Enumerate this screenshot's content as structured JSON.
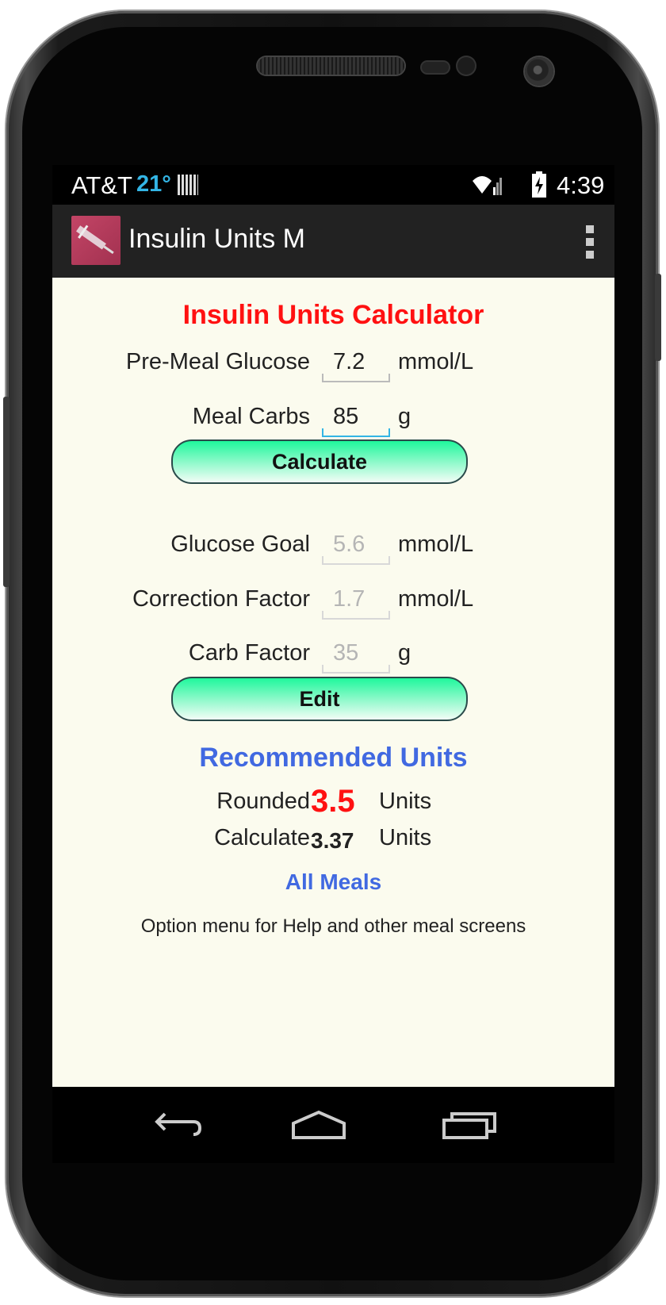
{
  "status_bar": {
    "carrier": "AT&T",
    "temperature": "21°",
    "time": "4:39"
  },
  "action_bar": {
    "title": "Insulin Units M",
    "app_icon": "syringe-icon",
    "menu_icon": "overflow-menu-icon"
  },
  "calculator": {
    "title": "Insulin Units Calculator",
    "pre_meal_glucose": {
      "label": "Pre-Meal Glucose",
      "value": "7.2",
      "unit": "mmol/L"
    },
    "meal_carbs": {
      "label": "Meal Carbs",
      "value": "85",
      "unit": "g"
    },
    "calculate_label": "Calculate"
  },
  "settings": {
    "glucose_goal": {
      "label": "Glucose Goal",
      "value": "5.6",
      "unit": "mmol/L"
    },
    "correction_factor": {
      "label": "Correction Factor",
      "value": "1.7",
      "unit": "mmol/L"
    },
    "carb_factor": {
      "label": "Carb Factor",
      "value": "35",
      "unit": "g"
    },
    "edit_label": "Edit"
  },
  "results": {
    "title": "Recommended Units",
    "rounded": {
      "label": "Rounded",
      "value": "3.5",
      "unit": "Units"
    },
    "calculated": {
      "label": "Calculate",
      "value": "3.37",
      "unit": "Units"
    },
    "all_meals_label": "All Meals"
  },
  "hint": "Option menu for Help and other meal screens",
  "nav_bar": {
    "back_icon": "back-icon",
    "home_icon": "home-icon",
    "recents_icon": "recent-apps-icon"
  },
  "colors": {
    "title_red": "#ff1111",
    "section_blue": "#4169e1",
    "content_bg": "#fbfbee",
    "action_bar": "#222222",
    "accent": "#33b5e5"
  }
}
